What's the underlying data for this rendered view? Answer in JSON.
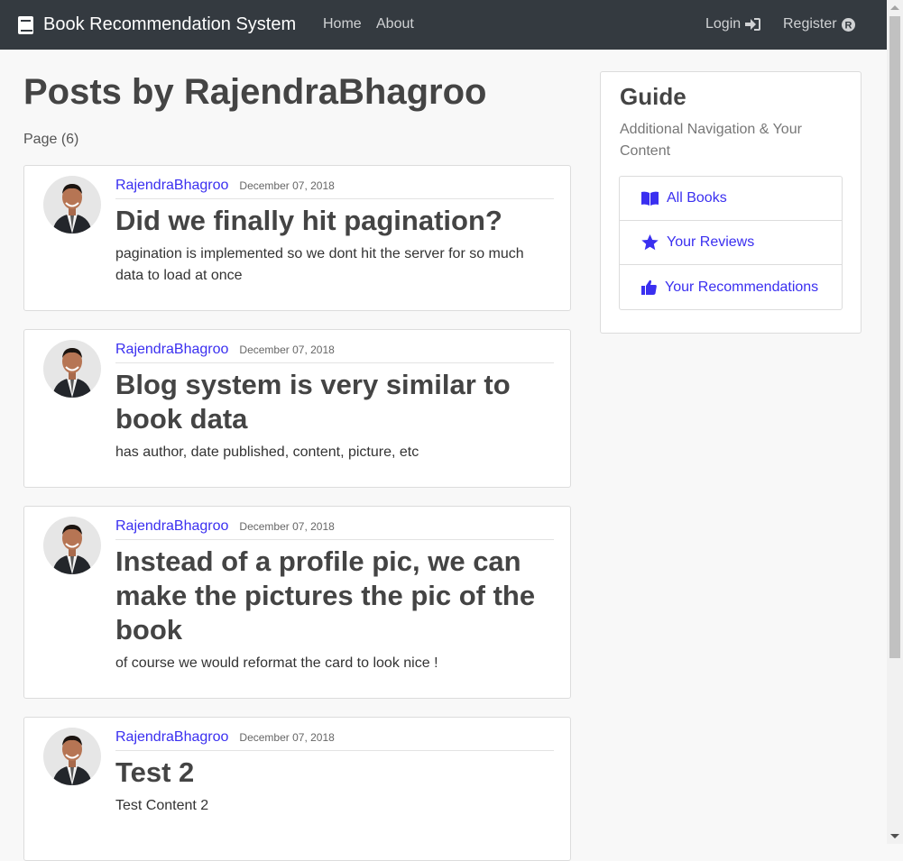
{
  "navbar": {
    "brand": "Book Recommendation System",
    "links": [
      "Home",
      "About"
    ],
    "login": "Login",
    "register": "Register"
  },
  "main": {
    "title": "Posts by RajendraBhagroo",
    "page": "Page (6)"
  },
  "posts": [
    {
      "author": "RajendraBhagroo",
      "date": "December 07, 2018",
      "title": "Did we finally hit pagination?",
      "content": "pagination is implemented so we dont hit the server for so much data to load at once"
    },
    {
      "author": "RajendraBhagroo",
      "date": "December 07, 2018",
      "title": "Blog system is very similar to book data",
      "content": "has author, date published, content, picture, etc"
    },
    {
      "author": "RajendraBhagroo",
      "date": "December 07, 2018",
      "title": "Instead of a profile pic, we can make the pictures the pic of the book",
      "content": "of course we would reformat the card to look nice !"
    },
    {
      "author": "RajendraBhagroo",
      "date": "December 07, 2018",
      "title": "Test 2",
      "content": "Test Content 2"
    }
  ],
  "guide": {
    "title": "Guide",
    "subtitle": "Additional Navigation & Your Content",
    "items": [
      {
        "label": "All Books",
        "icon": "book-open-icon"
      },
      {
        "label": "Your Reviews",
        "icon": "star-icon"
      },
      {
        "label": "Your Recommendations",
        "icon": "thumbs-up-icon"
      }
    ]
  },
  "colors": {
    "navbar": "#343a40",
    "link": "#3a2ff0",
    "background": "#f8f8f8"
  }
}
